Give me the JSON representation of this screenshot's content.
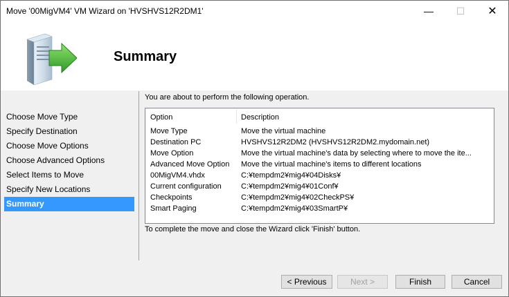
{
  "window": {
    "title": "Move '00MigVM4' VM Wizard on 'HVSHVS12R2DM1'",
    "minimize_glyph": "—",
    "maximize_glyph": "☐",
    "close_glyph": "✕"
  },
  "header": {
    "title": "Summary"
  },
  "sidebar": {
    "items": [
      {
        "label": "Choose Move Type"
      },
      {
        "label": "Specify Destination"
      },
      {
        "label": "Choose Move Options"
      },
      {
        "label": "Choose Advanced Options"
      },
      {
        "label": "Select Items to Move"
      },
      {
        "label": "Specify New Locations"
      },
      {
        "label": "Summary"
      }
    ],
    "active_index": 6,
    "active_color": "#3399ff"
  },
  "main": {
    "intro": "You are about to perform the following operation.",
    "columns": {
      "option": "Option",
      "description": "Description"
    },
    "rows": [
      {
        "option": "Move Type",
        "description": "Move the virtual machine"
      },
      {
        "option": "Destination PC",
        "description": "HVSHVS12R2DM2 (HVSHVS12R2DM2.mydomain.net)"
      },
      {
        "option": "Move Option",
        "description": "Move the virtual machine's data by selecting where to move the ite..."
      },
      {
        "option": "Advanced Move Option",
        "description": "Move the virtual machine's items to different locations"
      },
      {
        "option": "00MigVM4.vhdx",
        "description": "C:¥tempdm2¥mig4¥04Disks¥"
      },
      {
        "option": "Current configuration",
        "description": "C:¥tempdm2¥mig4¥01Conf¥"
      },
      {
        "option": "Checkpoints",
        "description": "C:¥tempdm2¥mig4¥02CheckPS¥"
      },
      {
        "option": "Smart Paging",
        "description": "C:¥tempdm2¥mig4¥03SmartP¥"
      }
    ],
    "outro": "To complete the move and close the Wizard click 'Finish' button."
  },
  "buttons": {
    "previous": "< Previous",
    "next": "Next >",
    "finish": "Finish",
    "cancel": "Cancel"
  }
}
